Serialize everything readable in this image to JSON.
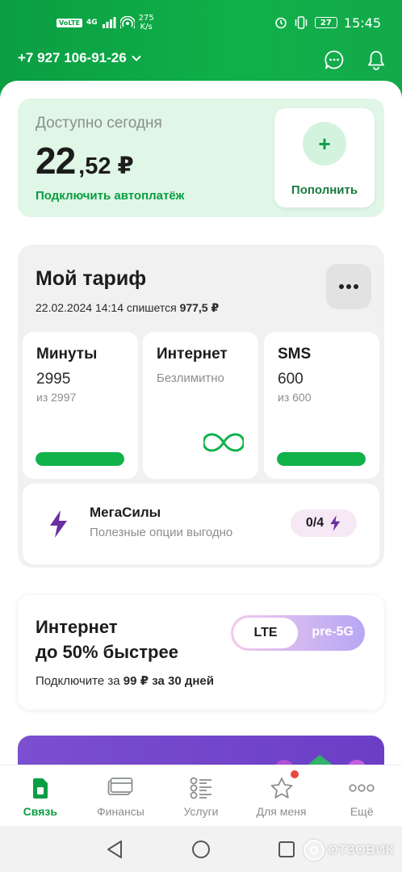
{
  "status_bar": {
    "network": "4G",
    "volte": "VoLTE",
    "speed_value": "275",
    "speed_unit": "K/s",
    "battery": "27",
    "time": "15:45"
  },
  "header": {
    "phone": "+7 927 106-91-26",
    "icons": [
      "chat-icon",
      "bell-icon"
    ]
  },
  "balance": {
    "label": "Доступно сегодня",
    "amount_int": "22",
    "amount_frac": ",52 ₽",
    "autopay_link": "Подключить автоплатёж",
    "topup_label": "Пополнить"
  },
  "tariff": {
    "title": "Мой тариф",
    "charge_prefix": "22.02.2024 14:14 спишется ",
    "charge_amount": "977,5 ₽",
    "packages": [
      {
        "name": "Минуты",
        "value": "2995",
        "of": "из 2997",
        "fraction": 0.999
      },
      {
        "name": "Интернет",
        "value": "Безлимитно"
      },
      {
        "name": "SMS",
        "value": "600",
        "of": "из 600",
        "fraction": 1.0
      }
    ],
    "megasily": {
      "name": "МегаСилы",
      "desc": "Полезные опции выгодно",
      "badge": "0/4"
    }
  },
  "promo": {
    "title_line1": "Интернет",
    "title_line2": "до 50% быстрее",
    "sub_prefix": "Подключите за ",
    "sub_price": "99 ₽ за 30 дней",
    "toggle_left": "LTE",
    "toggle_right": "pre-5G"
  },
  "bottom_nav": [
    {
      "label": "Связь",
      "icon": "sim-icon",
      "active": true
    },
    {
      "label": "Финансы",
      "icon": "card-icon"
    },
    {
      "label": "Услуги",
      "icon": "services-icon"
    },
    {
      "label": "Для меня",
      "icon": "star-icon"
    },
    {
      "label": "Ещё",
      "icon": "more-icon"
    }
  ],
  "watermark": "ОТЗОВИК",
  "colors": {
    "brand_green": "#0a9e43",
    "accent_green": "#12b24b",
    "purple": "#6b2fa0"
  }
}
